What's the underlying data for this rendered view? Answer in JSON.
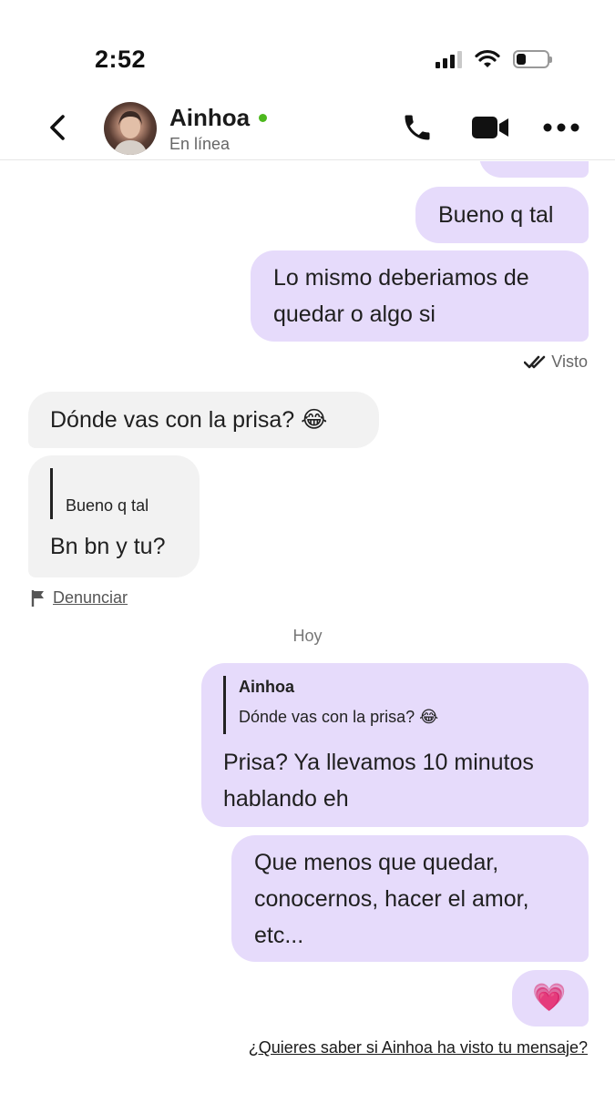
{
  "status_bar": {
    "time": "2:52",
    "battery_level": 0.3
  },
  "header": {
    "contact_name": "Ainhoa",
    "contact_status": "En línea",
    "online_color": "#4cb81d"
  },
  "colors": {
    "outgoing_bubble": "#e6dbfb",
    "incoming_bubble": "#f2f2f2"
  },
  "messages": [
    {
      "direction": "out",
      "text": "Bueno q tal"
    },
    {
      "direction": "out",
      "text": "Lo mismo deberiamos de quedar o algo si",
      "lines": [
        "Lo mismo deberiamos de",
        "quedar o algo si"
      ]
    },
    {
      "direction": "in",
      "text": "Dónde vas con la prisa? 😂"
    },
    {
      "direction": "in",
      "quote_text": "Bueno q tal",
      "text": "Bn bn y tu?"
    },
    {
      "direction": "out",
      "quote_name": "Ainhoa",
      "quote_text": "Dónde vas con la prisa? 😂",
      "lines": [
        "Prisa? Ya llevamos 10 minutos",
        "hablando eh"
      ]
    },
    {
      "direction": "out",
      "lines": [
        "Que menos que quedar,",
        "conocernos, hacer el amor,",
        "etc..."
      ]
    },
    {
      "direction": "out",
      "text": "💗"
    }
  ],
  "seen_label": "Visto",
  "report_label": "Denunciar",
  "day_separator": "Hoy",
  "bottom_link": "¿Quieres saber si Ainhoa ha visto tu mensaje?"
}
